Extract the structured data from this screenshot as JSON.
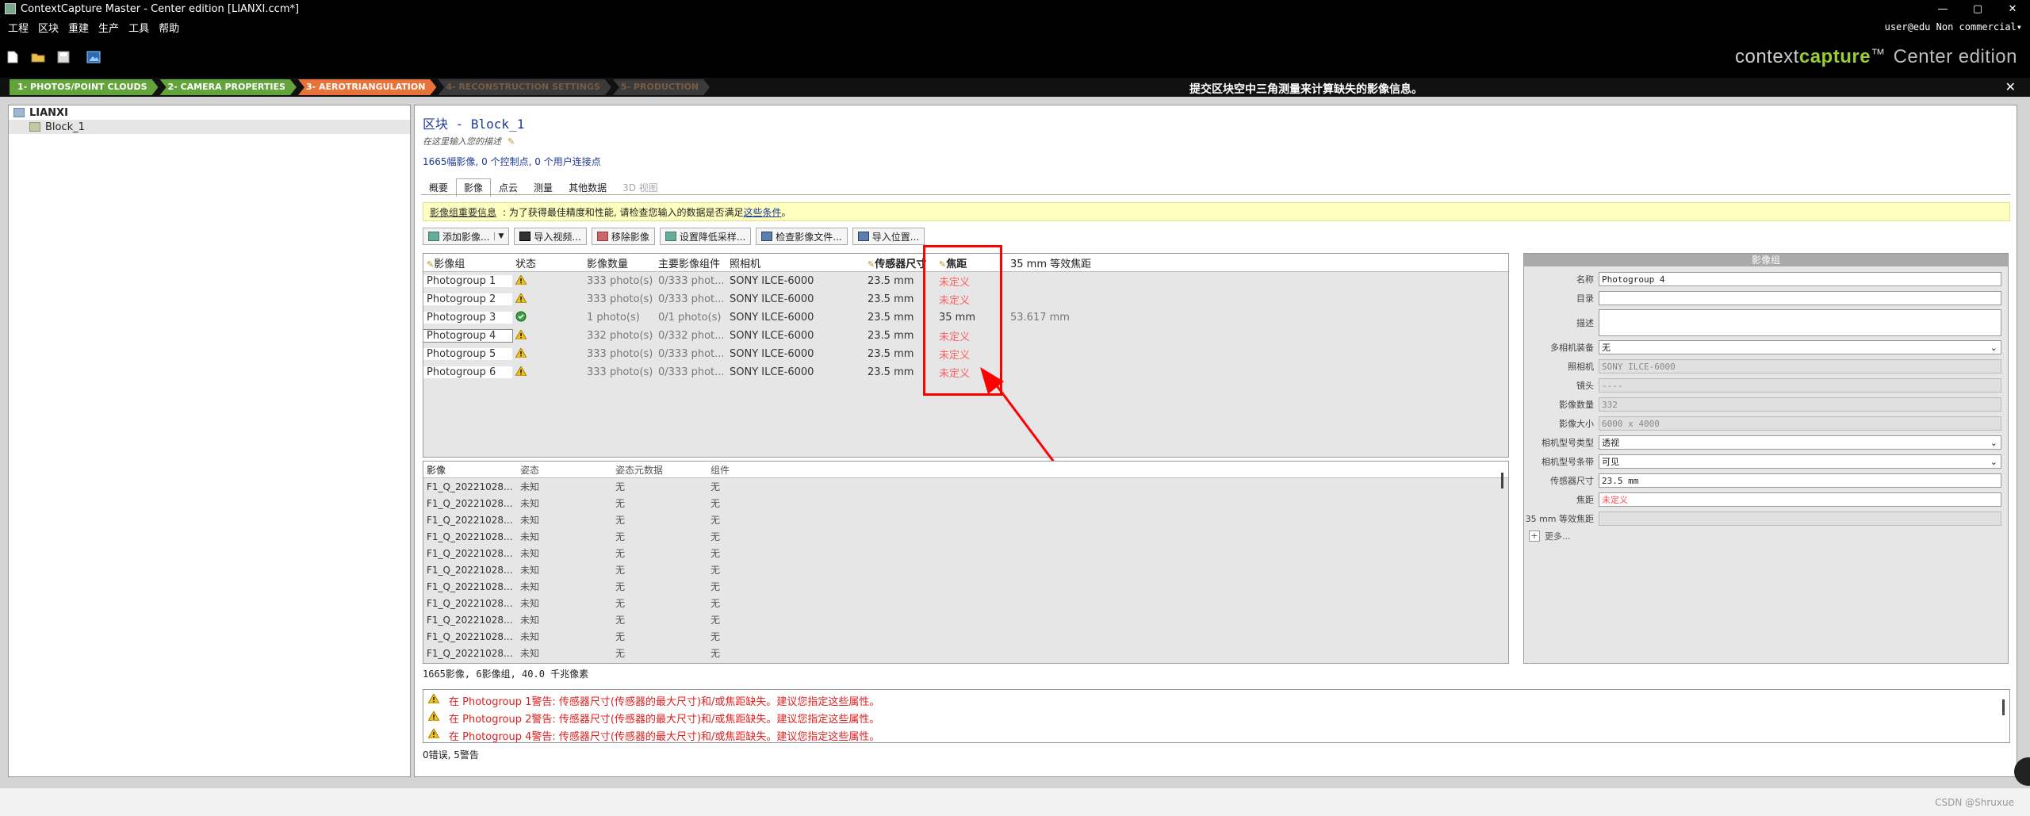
{
  "window": {
    "title": "ContextCapture Master - Center edition [LIANXI.ccm*]",
    "controls": [
      "—",
      "▢",
      "✕"
    ]
  },
  "menu": {
    "items": [
      "工程",
      "区块",
      "重建",
      "生产",
      "工具",
      "帮助"
    ],
    "user": "user@edu Non commercial▾"
  },
  "brand": {
    "context": "context",
    "capture": "capture",
    "tm": "™",
    "edition": "Center edition"
  },
  "steps": [
    {
      "label": "1- PHOTOS/POINT CLOUDS",
      "state": "done"
    },
    {
      "label": "2- CAMERA PROPERTIES",
      "state": "done"
    },
    {
      "label": "3- AEROTRIANGULATION",
      "state": "active"
    },
    {
      "label": "4- RECONSTRUCTION SETTINGS",
      "state": "todo"
    },
    {
      "label": "5- PRODUCTION",
      "state": "todo"
    }
  ],
  "step_hint": "提交区块空中三角测量来计算缺失的影像信息。",
  "tree": {
    "root": "LIANXI",
    "child": "Block_1"
  },
  "block": {
    "title": "区块 - Block_1",
    "description": "在这里输入您的描述",
    "summary": "1665幅影像, 0 个控制点, 0 个用户连接点"
  },
  "tabs": [
    "概要",
    "影像",
    "点云",
    "测量",
    "其他数据",
    "3D 视图"
  ],
  "infobar": {
    "lead": "影像组重要信息",
    "text": ": 为了获得最佳精度和性能, 请检查您输入的数据是否满足",
    "link": "这些条件",
    "tail": "。"
  },
  "actions": [
    "添加影像...",
    "导入视频...",
    "移除影像",
    "设置降低采样...",
    "检查影像文件...",
    "导入位置..."
  ],
  "photogroups": {
    "headers": {
      "name": "影像组",
      "status": "状态",
      "count": "影像数量",
      "main": "主要影像组件",
      "camera": "照相机",
      "sensor": "传感器尺寸",
      "focal": "焦距",
      "f35": "35 mm 等效焦距"
    },
    "rows": [
      {
        "name": "Photogroup 1",
        "status": "warn",
        "count": "333 photo(s)",
        "main": "0/333 phot...",
        "camera": "SONY ILCE-6000",
        "sensor": "23.5 mm",
        "focal": "未定义",
        "f35": ""
      },
      {
        "name": "Photogroup 2",
        "status": "warn",
        "count": "333 photo(s)",
        "main": "0/333 phot...",
        "camera": "SONY ILCE-6000",
        "sensor": "23.5 mm",
        "focal": "未定义",
        "f35": ""
      },
      {
        "name": "Photogroup 3",
        "status": "ok",
        "count": "1 photo(s)",
        "main": "0/1 photo(s)",
        "camera": "SONY ILCE-6000",
        "sensor": "23.5 mm",
        "focal": "35 mm",
        "f35": "53.617 mm"
      },
      {
        "name": "Photogroup 4",
        "status": "warn",
        "count": "332 photo(s)",
        "main": "0/332 phot...",
        "camera": "SONY ILCE-6000",
        "sensor": "23.5 mm",
        "focal": "未定义",
        "f35": ""
      },
      {
        "name": "Photogroup 5",
        "status": "warn",
        "count": "333 photo(s)",
        "main": "0/333 phot...",
        "camera": "SONY ILCE-6000",
        "sensor": "23.5 mm",
        "focal": "未定义",
        "f35": ""
      },
      {
        "name": "Photogroup 6",
        "status": "warn",
        "count": "333 photo(s)",
        "main": "0/333 phot...",
        "camera": "SONY ILCE-6000",
        "sensor": "23.5 mm",
        "focal": "未定义",
        "f35": ""
      }
    ]
  },
  "images": {
    "headers": {
      "name": "影像",
      "pose": "姿态",
      "meta": "姿态元数据",
      "comp": "组件"
    },
    "rows": [
      {
        "name": "F1_Q_20221028...",
        "pose": "未知",
        "meta": "无",
        "comp": "无"
      },
      {
        "name": "F1_Q_20221028...",
        "pose": "未知",
        "meta": "无",
        "comp": "无"
      },
      {
        "name": "F1_Q_20221028...",
        "pose": "未知",
        "meta": "无",
        "comp": "无"
      },
      {
        "name": "F1_Q_20221028...",
        "pose": "未知",
        "meta": "无",
        "comp": "无"
      },
      {
        "name": "F1_Q_20221028...",
        "pose": "未知",
        "meta": "无",
        "comp": "无"
      },
      {
        "name": "F1_Q_20221028...",
        "pose": "未知",
        "meta": "无",
        "comp": "无"
      },
      {
        "name": "F1_Q_20221028...",
        "pose": "未知",
        "meta": "无",
        "comp": "无"
      },
      {
        "name": "F1_Q_20221028...",
        "pose": "未知",
        "meta": "无",
        "comp": "无"
      },
      {
        "name": "F1_Q_20221028...",
        "pose": "未知",
        "meta": "无",
        "comp": "无"
      },
      {
        "name": "F1_Q_20221028...",
        "pose": "未知",
        "meta": "无",
        "comp": "无"
      },
      {
        "name": "F1_Q_20221028...",
        "pose": "未知",
        "meta": "无",
        "comp": "无"
      }
    ],
    "footer": "1665影像, 6影像组, 40.0 千兆像素"
  },
  "warnings": [
    "在 Photogroup 1警告: 传感器尺寸(传感器的最大尺寸)和/或焦距缺失。建议您指定这些属性。",
    "在 Photogroup 2警告: 传感器尺寸(传感器的最大尺寸)和/或焦距缺失。建议您指定这些属性。",
    "在 Photogroup 4警告: 传感器尺寸(传感器的最大尺寸)和/或焦距缺失。建议您指定这些属性。"
  ],
  "error_summary": "0错误, 5警告",
  "props": {
    "header": "影像组",
    "name_label": "名称",
    "name_value": "Photogroup 4",
    "dir_label": "目录",
    "dir_value": "",
    "desc_label": "描述",
    "desc_value": "",
    "rig_label": "多相机装备",
    "rig_value": "无",
    "camera_label": "照相机",
    "camera_value": "SONY ILCE-6000",
    "lens_label": "镜头",
    "lens_value": "----",
    "count_label": "影像数量",
    "count_value": "332",
    "size_label": "影像大小",
    "size_value": "6000 x 4000",
    "model_label": "相机型号类型",
    "model_value": "透视",
    "band_label": "相机型号条带",
    "band_value": "可见",
    "sensor_label": "传感器尺寸",
    "sensor_value": "23.5 mm",
    "focal_label": "焦距",
    "focal_value": "未定义",
    "f35_label": "35 mm 等效焦距",
    "f35_value": "",
    "more": "更多..."
  },
  "watermark": "CSDN @Shruxue",
  "colors": {
    "accent_green": "#63a33c",
    "accent_orange": "#e8733a",
    "annotation_red": "#ff0000",
    "undefined_text": "#ff6060"
  }
}
